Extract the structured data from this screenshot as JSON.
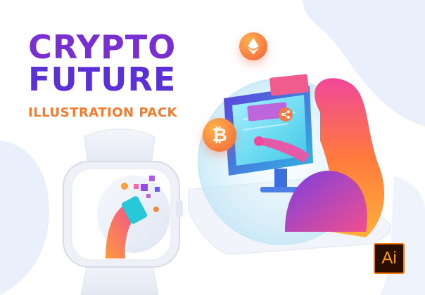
{
  "hero": {
    "title_line1": "CRYPTO",
    "title_line2": "FUTURE",
    "subtitle": "ILLUSTRATION PACK"
  },
  "badges": {
    "bitcoin_symbol": "₿",
    "ai_badge_label": "Ai"
  },
  "icons": {
    "bitcoin_coin": "bitcoin-icon",
    "ethereum_coin": "ethereum-icon",
    "share_bubble": "share-icon",
    "ai_badge": "adobe-illustrator-icon"
  },
  "colors": {
    "title_purple": "#7a2fd0",
    "subtitle_orange": "#f47a2e",
    "coin_orange": "#f2643c",
    "background_blob": "#eaf0fb",
    "ai_badge_orange": "#ff7c00"
  }
}
